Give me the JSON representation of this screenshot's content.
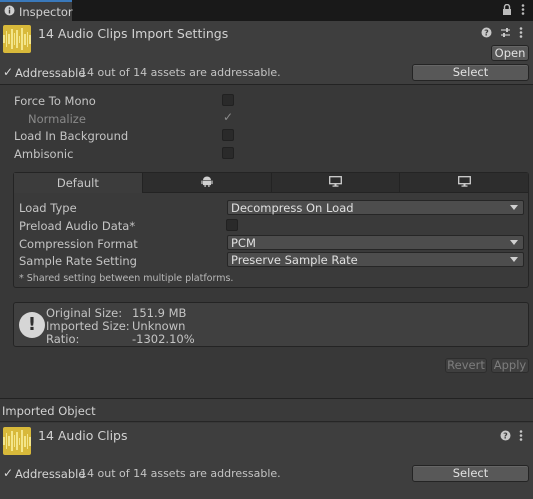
{
  "tab": {
    "icon": "info-icon",
    "label": "Inspector"
  },
  "tab_icons": [
    "lock-icon",
    "more-icon"
  ],
  "header": {
    "title": "14 Audio Clips Import Settings",
    "icons": [
      "help-icon",
      "preset-icon",
      "menu-icon"
    ],
    "open_label": "Open",
    "addressable_label": "Addressable",
    "addressable_status": "14 out of 14 assets are addressable.",
    "select_label": "Select"
  },
  "options": [
    {
      "label": "Force To Mono",
      "checked": false
    },
    {
      "label": "Normalize",
      "checked": true,
      "disabled": true
    },
    {
      "label": "Load In Background",
      "checked": false
    },
    {
      "label": "Ambisonic",
      "checked": false
    }
  ],
  "platform_tabs": [
    {
      "label": "Default",
      "icon": ""
    },
    {
      "label": "",
      "icon": "android-icon"
    },
    {
      "label": "",
      "icon": "monitor-icon"
    },
    {
      "label": "",
      "icon": "monitor-icon"
    }
  ],
  "settings": {
    "load_type_label": "Load Type",
    "load_type_value": "Decompress On Load",
    "preload_label": "Preload Audio Data*",
    "compression_label": "Compression Format",
    "compression_value": "PCM",
    "sample_rate_label": "Sample Rate Setting",
    "sample_rate_value": "Preserve Sample Rate",
    "note": "* Shared setting between multiple platforms."
  },
  "info": {
    "original_size_label": "Original Size:",
    "original_size_value": "151.9 MB",
    "imported_size_label": "Imported Size:",
    "imported_size_value": "Unknown",
    "ratio_label": "Ratio:",
    "ratio_value": "-1302.10%"
  },
  "actions": {
    "revert_label": "Revert",
    "apply_label": "Apply"
  },
  "imported_object": {
    "section_title": "Imported Object",
    "title": "14 Audio Clips",
    "addressable_label": "Addressable",
    "addressable_status": "14 out of 14 assets are addressable.",
    "select_label": "Select"
  },
  "colors": {
    "accent": "#3a79bb",
    "audio_icon": "#d8b93a",
    "background": "#383838"
  }
}
